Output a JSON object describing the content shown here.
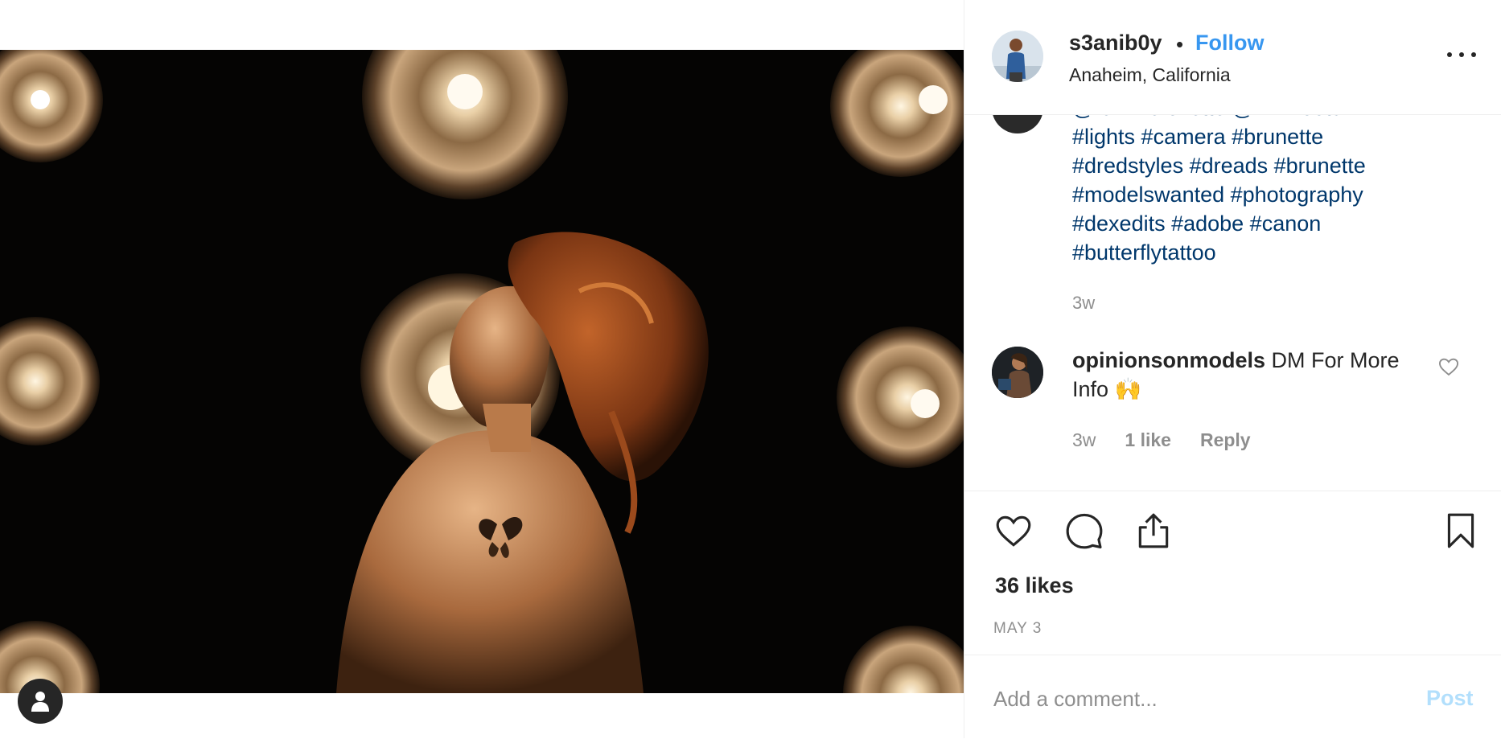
{
  "post": {
    "owner": {
      "username": "s3anib0y",
      "separator": "•",
      "follow_label": "Follow",
      "location": "Anaheim, California",
      "avatar_icon": "user-photo-avatar"
    },
    "more_icon": "more-options-icon",
    "caption": {
      "clipped_line": "@femmefoxette @im.meets",
      "lines": [
        "#lights #camera #brunette",
        "#dredstyles #dreads #brunette",
        "#modelswanted #photography",
        "#dexedits #adobe #canon",
        "#butterflytattoo"
      ],
      "time": "3w"
    },
    "comments": [
      {
        "username": "opinionsonmodels",
        "text": "DM For More Info 🙌",
        "time": "3w",
        "likes": "1 like",
        "reply_label": "Reply"
      }
    ],
    "likes": "36 likes",
    "date": "MAY 3",
    "add_comment": {
      "placeholder": "Add a comment...",
      "post_label": "Post"
    }
  },
  "colors": {
    "link_blue": "#3897f0",
    "hashtag_blue": "#00376b",
    "secondary_text": "#8e8e8e",
    "post_disabled": "#b2dffc",
    "divider": "#efefef",
    "photo_background": "#050403"
  }
}
